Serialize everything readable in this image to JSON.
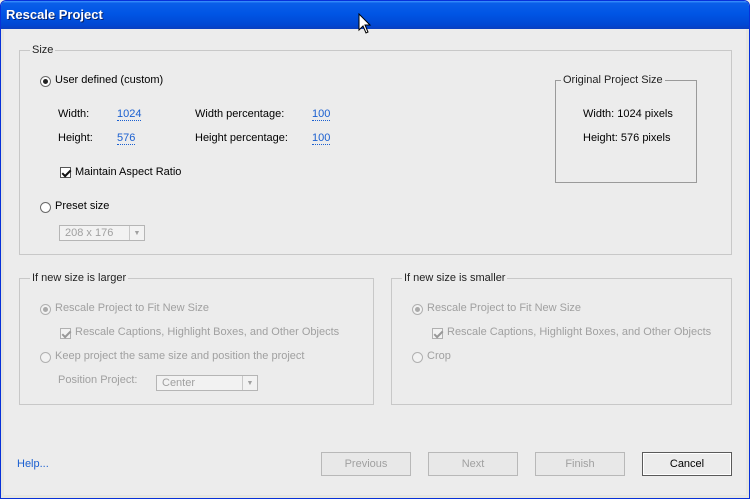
{
  "window": {
    "title": "Rescale Project"
  },
  "size": {
    "legend": "Size",
    "user_defined_label": "User defined (custom)",
    "width_label": "Width:",
    "width_value": "1024",
    "height_label": "Height:",
    "height_value": "576",
    "width_pct_label": "Width percentage:",
    "width_pct_value": "100",
    "height_pct_label": "Height percentage:",
    "height_pct_value": "100",
    "maintain_aspect_label": "Maintain Aspect Ratio",
    "maintain_aspect_checked": true,
    "preset_label": "Preset size",
    "preset_value": "208 x 176",
    "original": {
      "legend": "Original Project Size",
      "width_text": "Width: 1024 pixels",
      "height_text": "Height: 576 pixels"
    }
  },
  "larger": {
    "legend": "If new size is larger",
    "rescale_fit_label": "Rescale Project to Fit New Size",
    "rescale_captions_label": "Rescale Captions, Highlight Boxes, and Other Objects",
    "keep_same_label": "Keep project the same size and position the project",
    "position_label": "Position Project:",
    "position_value": "Center"
  },
  "smaller": {
    "legend": "If new size is smaller",
    "rescale_fit_label": "Rescale Project to Fit New Size",
    "rescale_captions_label": "Rescale Captions, Highlight Boxes, and Other Objects",
    "crop_label": "Crop"
  },
  "footer": {
    "help_label": "Help...",
    "previous_label": "Previous",
    "next_label": "Next",
    "finish_label": "Finish",
    "cancel_label": "Cancel"
  }
}
